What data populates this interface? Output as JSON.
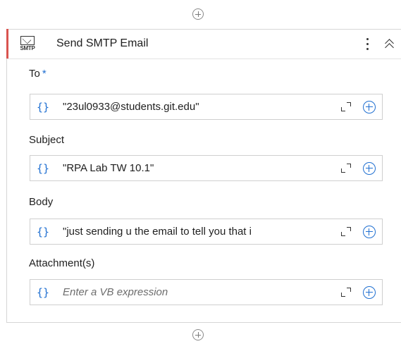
{
  "activity": {
    "title": "Send SMTP Email",
    "icon_text": "SMTP",
    "icon": "smtp-envelope-icon"
  },
  "fields": [
    {
      "label": "To",
      "required_mark": "*",
      "brace": "{}",
      "value": "\"23ul0933@students.git.edu\""
    },
    {
      "label": "Subject",
      "brace": "{}",
      "value": "\"RPA Lab TW 10.1\""
    },
    {
      "label": "Body",
      "brace": "{}",
      "value": "\"just sending u the email to tell you that i"
    },
    {
      "label": "Attachment(s)",
      "brace": "{}",
      "placeholder": "Enter a VB expression"
    }
  ],
  "colors": {
    "accent": "#d9534f",
    "link": "#1f6fd1"
  }
}
